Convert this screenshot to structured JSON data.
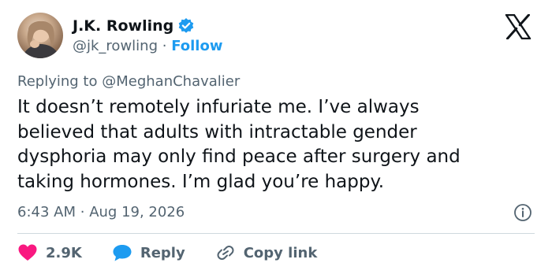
{
  "author": {
    "name": "J.K. Rowling",
    "handle": "@jk_rowling",
    "separator": "·",
    "follow_label": "Follow"
  },
  "reply": {
    "prefix": "Replying to",
    "mention": "@MeghanChavalier"
  },
  "tweet": {
    "text": "It doesn’t remotely infuriate me. I’ve always\nbelieved that adults with intractable gender\ndysphoria may only find peace after surgery and\ntaking hormones. I’m glad you’re happy."
  },
  "meta": {
    "time": "6:43 AM",
    "separator": "·",
    "date": "Aug 19, 2026"
  },
  "actions": {
    "likes": "2.9K",
    "reply_label": "Reply",
    "copy_label": "Copy link"
  },
  "icons": {
    "brand": "x-logo-icon",
    "verified": "verified-badge-icon",
    "like": "heart-icon",
    "reply": "speech-bubble-icon",
    "copy": "link-icon",
    "info": "info-icon"
  },
  "colors": {
    "accent": "#1d9bf0",
    "like": "#f91880",
    "muted": "#536471",
    "text": "#0f1419"
  }
}
